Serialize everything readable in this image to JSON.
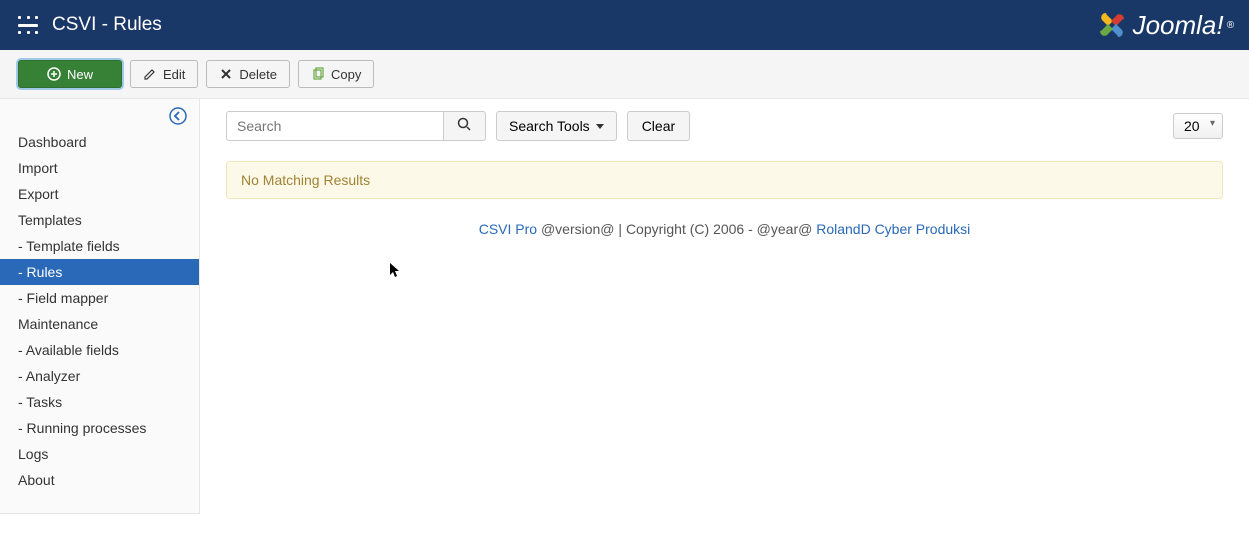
{
  "header": {
    "title": "CSVI - Rules",
    "brand": "Joomla!"
  },
  "toolbar": {
    "new": "New",
    "edit": "Edit",
    "delete": "Delete",
    "copy": "Copy"
  },
  "sidebar": {
    "items": [
      {
        "label": "Dashboard",
        "active": false
      },
      {
        "label": "Import",
        "active": false
      },
      {
        "label": "Export",
        "active": false
      },
      {
        "label": "Templates",
        "active": false
      },
      {
        "label": "- Template fields",
        "active": false
      },
      {
        "label": "- Rules",
        "active": true
      },
      {
        "label": "- Field mapper",
        "active": false
      },
      {
        "label": "Maintenance",
        "active": false
      },
      {
        "label": "- Available fields",
        "active": false
      },
      {
        "label": "- Analyzer",
        "active": false
      },
      {
        "label": "- Tasks",
        "active": false
      },
      {
        "label": "- Running processes",
        "active": false
      },
      {
        "label": "Logs",
        "active": false
      },
      {
        "label": "About",
        "active": false
      }
    ]
  },
  "filters": {
    "search_placeholder": "Search",
    "search_tools": "Search Tools",
    "clear": "Clear",
    "limit": "20"
  },
  "alert": {
    "message": "No Matching Results"
  },
  "footer": {
    "link1": "CSVI Pro",
    "text": " @version@ | Copyright (C) 2006 - @year@ ",
    "link2": "RolandD Cyber Produksi"
  }
}
